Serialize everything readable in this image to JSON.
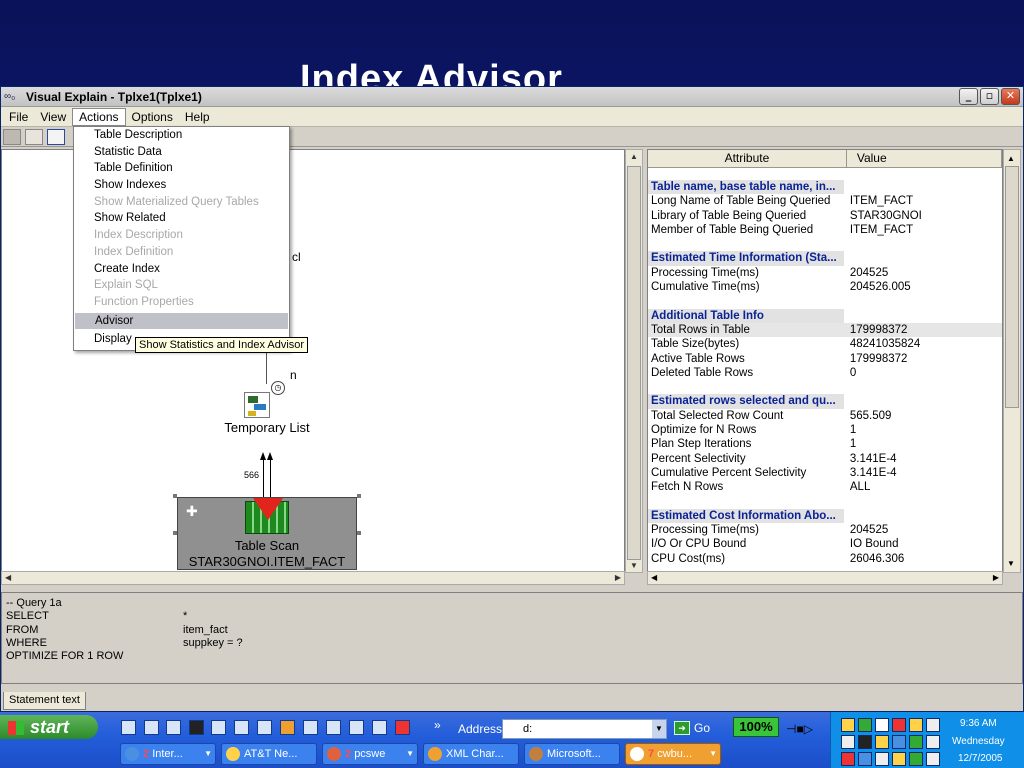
{
  "slide_title": "Index Advisor",
  "window": {
    "title": "Visual Explain - Tplxe1(Tplxe1)",
    "controls": [
      "_",
      "▫",
      "✕"
    ]
  },
  "menubar": [
    "File",
    "View",
    "Actions",
    "Options",
    "Help"
  ],
  "actions_menu": [
    {
      "label": "Table Description",
      "enabled": true
    },
    {
      "label": "Statistic Data",
      "enabled": true
    },
    {
      "label": "Table Definition",
      "enabled": true
    },
    {
      "label": "Show Indexes",
      "enabled": true
    },
    {
      "label": "Show Materialized Query Tables",
      "enabled": false
    },
    {
      "label": "Show Related",
      "enabled": true
    },
    {
      "label": "Index Description",
      "enabled": false
    },
    {
      "label": "Index Definition",
      "enabled": false
    },
    {
      "label": "Create Index",
      "enabled": true
    },
    {
      "label": "Explain SQL",
      "enabled": false
    },
    {
      "label": "Function Properties",
      "enabled": false
    },
    {
      "label": "Advisor",
      "enabled": true,
      "highlighted": true
    },
    {
      "label": "Display",
      "enabled": true
    }
  ],
  "tooltip": "Show Statistics and Index Advisor",
  "graph": {
    "partial_labels": [
      "cl",
      "n"
    ],
    "temp_list_label": "Temporary List",
    "row_count": "566",
    "scan_node": {
      "title": "Table Scan",
      "table": "STAR30GNOI.ITEM_FACT"
    }
  },
  "attributes": {
    "header": {
      "attribute": "Attribute",
      "value": "Value"
    },
    "sections": [
      {
        "title": "Table name, base table name, in...",
        "rows": [
          {
            "attribute": "Long Name of Table Being Queried",
            "value": "ITEM_FACT"
          },
          {
            "attribute": "Library of Table Being Queried",
            "value": "STAR30GNOI"
          },
          {
            "attribute": "Member of Table Being Queried",
            "value": "ITEM_FACT"
          }
        ]
      },
      {
        "title": "Estimated Time Information (Sta...",
        "rows": [
          {
            "attribute": "Processing Time(ms)",
            "value": "204525"
          },
          {
            "attribute": "Cumulative Time(ms)",
            "value": "204526.005"
          }
        ]
      },
      {
        "title": "Additional Table Info",
        "rows": [
          {
            "attribute": "Total Rows in Table",
            "value": "179998372",
            "selected": true
          },
          {
            "attribute": "Table Size(bytes)",
            "value": "48241035824"
          },
          {
            "attribute": "Active Table Rows",
            "value": "179998372"
          },
          {
            "attribute": "Deleted Table Rows",
            "value": "0"
          }
        ]
      },
      {
        "title": "Estimated rows selected and qu...",
        "rows": [
          {
            "attribute": "Total Selected Row Count",
            "value": "565.509"
          },
          {
            "attribute": "Optimize for N Rows",
            "value": "1"
          },
          {
            "attribute": "Plan Step Iterations",
            "value": "1"
          },
          {
            "attribute": "Percent Selectivity",
            "value": "3.141E-4"
          },
          {
            "attribute": "Cumulative Percent Selectivity",
            "value": "3.141E-4"
          },
          {
            "attribute": "Fetch N Rows",
            "value": "ALL"
          }
        ]
      },
      {
        "title": "Estimated Cost Information Abo...",
        "rows": [
          {
            "attribute": "Processing Time(ms)",
            "value": "204525"
          },
          {
            "attribute": "I/O Or CPU Bound",
            "value": "IO Bound"
          },
          {
            "attribute": "CPU Cost(ms)",
            "value": "26046.306"
          }
        ]
      }
    ]
  },
  "sql": {
    "lines": [
      {
        "keyword": "-- Query 1a",
        "value": ""
      },
      {
        "keyword": "SELECT",
        "value": "*"
      },
      {
        "keyword": "FROM",
        "value": "item_fact"
      },
      {
        "keyword": "WHERE",
        "value": "suppkey = ?"
      },
      {
        "keyword": "OPTIMIZE FOR 1 ROW",
        "value": ""
      }
    ],
    "tab_label": "Statement text"
  },
  "taskbar": {
    "start_label": "start",
    "address_label": "Address",
    "address_value": "d:",
    "go_label": "Go",
    "battery": "100%",
    "clock_time": "9:36 AM",
    "clock_day": "Wednesday",
    "clock_date": "12/7/2005",
    "buttons": [
      {
        "count": "2",
        "label": "Inter..."
      },
      {
        "count": "",
        "label": "AT&T Ne..."
      },
      {
        "count": "2",
        "label": "pcswe"
      },
      {
        "count": "",
        "label": "XML Char..."
      },
      {
        "count": "",
        "label": "Microsoft..."
      },
      {
        "count": "7",
        "label": "cwbu..."
      }
    ]
  }
}
